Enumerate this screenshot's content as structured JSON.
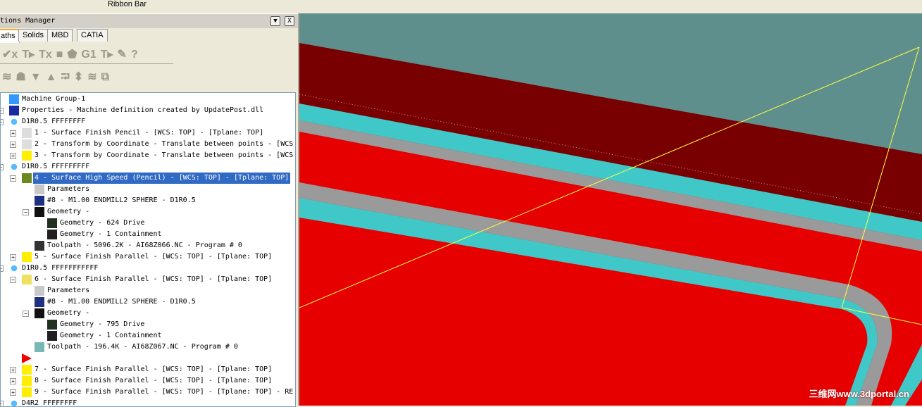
{
  "ribbon": {
    "title": "Ribbon Bar"
  },
  "panel": {
    "title": "tions Manager",
    "tabs": [
      "aths",
      "Solids",
      "MBD",
      "CATIA"
    ],
    "toolbar1": [
      "✔x",
      "T▸",
      "Tx",
      "■",
      "⬟",
      "G1",
      "T▸",
      "✎",
      "?"
    ],
    "toolbar2": [
      "≋",
      "☗",
      "▼",
      "▲",
      "⮒",
      "⬍",
      "≋",
      "⧉"
    ]
  },
  "tree": [
    {
      "level": 0,
      "icon": "machine-group",
      "text": "Machine Group-1",
      "exp": ""
    },
    {
      "level": 0,
      "icon": "properties",
      "text": "Properties - Machine definition created by UpdatePost.dll",
      "exp": "+"
    },
    {
      "level": 0,
      "icon": "toolgroup",
      "text": "D1R0.5 FFFFFFFF",
      "exp": "-"
    },
    {
      "level": 1,
      "icon": "ghost",
      "text": "1 - Surface Finish Pencil - [WCS: TOP] - [Tplane: TOP]",
      "exp": "+"
    },
    {
      "level": 1,
      "icon": "ghost",
      "text": "2 - Transform by Coordinate - Translate between points - [WCS",
      "exp": "+"
    },
    {
      "level": 1,
      "icon": "folder",
      "text": "3 - Transform by Coordinate - Translate between points - [WCS",
      "exp": "+"
    },
    {
      "level": 0,
      "icon": "toolgroup",
      "text": "D1R0.5 FFFFFFFFF",
      "exp": "-"
    },
    {
      "level": 1,
      "icon": "folder-open-check",
      "text": "4 - Surface High Speed (Pencil) - [WCS: TOP] - [Tplane: TOP]",
      "exp": "-",
      "selected": true
    },
    {
      "level": 2,
      "icon": "parameters",
      "text": "Parameters",
      "exp": ""
    },
    {
      "level": 2,
      "icon": "tool",
      "text": "#8 - M1.00 ENDMILL2 SPHERE - D1R0.5",
      "exp": ""
    },
    {
      "level": 2,
      "icon": "geometry",
      "text": "Geometry -",
      "exp": "-"
    },
    {
      "level": 3,
      "icon": "geometry-drive",
      "text": "Geometry - 624 Drive",
      "exp": ""
    },
    {
      "level": 3,
      "icon": "geometry-containment",
      "text": "Geometry - 1 Containment",
      "exp": ""
    },
    {
      "level": 2,
      "icon": "toolpath-dark",
      "text": "Toolpath - 5096.2K - AI68Z066.NC - Program # 0",
      "exp": ""
    },
    {
      "level": 1,
      "icon": "folder",
      "text": "5 - Surface Finish Parallel - [WCS: TOP] - [Tplane: TOP]",
      "exp": "+"
    },
    {
      "level": 0,
      "icon": "toolgroup",
      "text": "D1R0.5 FFFFFFFFFFF",
      "exp": "-"
    },
    {
      "level": 1,
      "icon": "folder-open",
      "text": "6 - Surface Finish Parallel - [WCS: TOP] - [Tplane: TOP]",
      "exp": "-"
    },
    {
      "level": 2,
      "icon": "parameters",
      "text": "Parameters",
      "exp": ""
    },
    {
      "level": 2,
      "icon": "tool",
      "text": "#8 - M1.00 ENDMILL2 SPHERE - D1R0.5",
      "exp": ""
    },
    {
      "level": 2,
      "icon": "geometry",
      "text": "Geometry -",
      "exp": "-"
    },
    {
      "level": 3,
      "icon": "geometry-drive",
      "text": "Geometry - 795 Drive",
      "exp": ""
    },
    {
      "level": 3,
      "icon": "geometry-containment",
      "text": "Geometry - 1 Containment",
      "exp": ""
    },
    {
      "level": 2,
      "icon": "toolpath-light",
      "text": "Toolpath - 196.4K - AI68Z067.NC - Program # 0",
      "exp": ""
    },
    {
      "level": 1,
      "icon": "insert-arrow",
      "text": "",
      "exp": ""
    },
    {
      "level": 1,
      "icon": "folder",
      "text": "7 - Surface Finish Parallel - [WCS: TOP] - [Tplane: TOP]",
      "exp": "+"
    },
    {
      "level": 1,
      "icon": "folder",
      "text": "8 - Surface Finish Parallel - [WCS: TOP] - [Tplane: TOP]",
      "exp": "+"
    },
    {
      "level": 1,
      "icon": "folder",
      "text": "9 - Surface Finish Parallel - [WCS: TOP] - [Tplane: TOP] - RE",
      "exp": "+"
    },
    {
      "level": 0,
      "icon": "toolgroup",
      "text": "D4R2 FFFFFFFF",
      "exp": "-"
    }
  ],
  "viewport": {
    "watermark": "三维网www.3dportal.cn",
    "colors": {
      "background": "#5f8f8c",
      "part": "#e60000",
      "dark": "#780000",
      "path": "#40c8c8",
      "wire": "#ffff40"
    }
  }
}
